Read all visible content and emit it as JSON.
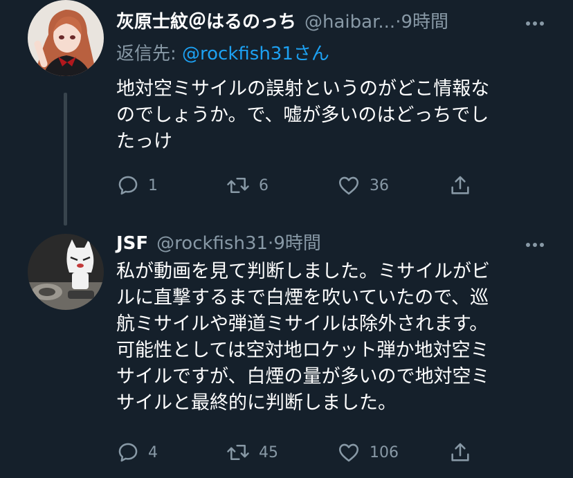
{
  "tweets": [
    {
      "display_name": "灰原士紋＠はるのっち",
      "handle": "@haibar...",
      "separator": "·",
      "time": "9時間",
      "reply_prefix": "返信先: ",
      "reply_mention": "@rockfish31",
      "reply_suffix": "さん",
      "text": "地対空ミサイルの誤射というのがどこ情報な\nのでしょうか。で、嘘が多いのはどっちでし\nたっけ",
      "replies": "1",
      "retweets": "6",
      "likes": "36",
      "avatar_icon": "anime-girl-avatar"
    },
    {
      "display_name": "JSF",
      "handle": "@rockfish31",
      "separator": "·",
      "time": "9時間",
      "text": "私が動画を見て判断しました。ミサイルがビ\nルに直撃するまで白煙を吹いていたので、巡\n航ミサイルや弾道ミサイルは除外されます。\n可能性としては空対地ロケット弾か地対空ミ\nサイルですが、白煙の量が多いので地対空ミ\nサイルと最終的に判断しました。",
      "replies": "4",
      "retweets": "45",
      "likes": "106",
      "avatar_icon": "white-cat-figure-avatar"
    }
  ],
  "more_icon": "ellipsis-icon",
  "colors": {
    "background": "#15202b",
    "secondary_text": "#8899a6",
    "link": "#1da1f2",
    "thread_line": "#38444d"
  }
}
